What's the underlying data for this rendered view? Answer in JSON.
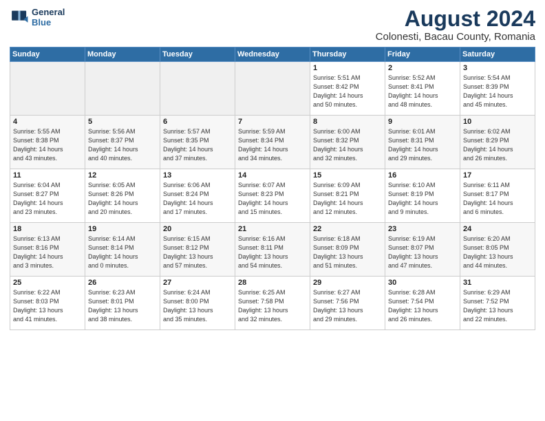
{
  "header": {
    "logo_line1": "General",
    "logo_line2": "Blue",
    "main_title": "August 2024",
    "subtitle": "Colonesti, Bacau County, Romania"
  },
  "weekdays": [
    "Sunday",
    "Monday",
    "Tuesday",
    "Wednesday",
    "Thursday",
    "Friday",
    "Saturday"
  ],
  "weeks": [
    [
      {
        "day": "",
        "info": ""
      },
      {
        "day": "",
        "info": ""
      },
      {
        "day": "",
        "info": ""
      },
      {
        "day": "",
        "info": ""
      },
      {
        "day": "1",
        "info": "Sunrise: 5:51 AM\nSunset: 8:42 PM\nDaylight: 14 hours\nand 50 minutes."
      },
      {
        "day": "2",
        "info": "Sunrise: 5:52 AM\nSunset: 8:41 PM\nDaylight: 14 hours\nand 48 minutes."
      },
      {
        "day": "3",
        "info": "Sunrise: 5:54 AM\nSunset: 8:39 PM\nDaylight: 14 hours\nand 45 minutes."
      }
    ],
    [
      {
        "day": "4",
        "info": "Sunrise: 5:55 AM\nSunset: 8:38 PM\nDaylight: 14 hours\nand 43 minutes."
      },
      {
        "day": "5",
        "info": "Sunrise: 5:56 AM\nSunset: 8:37 PM\nDaylight: 14 hours\nand 40 minutes."
      },
      {
        "day": "6",
        "info": "Sunrise: 5:57 AM\nSunset: 8:35 PM\nDaylight: 14 hours\nand 37 minutes."
      },
      {
        "day": "7",
        "info": "Sunrise: 5:59 AM\nSunset: 8:34 PM\nDaylight: 14 hours\nand 34 minutes."
      },
      {
        "day": "8",
        "info": "Sunrise: 6:00 AM\nSunset: 8:32 PM\nDaylight: 14 hours\nand 32 minutes."
      },
      {
        "day": "9",
        "info": "Sunrise: 6:01 AM\nSunset: 8:31 PM\nDaylight: 14 hours\nand 29 minutes."
      },
      {
        "day": "10",
        "info": "Sunrise: 6:02 AM\nSunset: 8:29 PM\nDaylight: 14 hours\nand 26 minutes."
      }
    ],
    [
      {
        "day": "11",
        "info": "Sunrise: 6:04 AM\nSunset: 8:27 PM\nDaylight: 14 hours\nand 23 minutes."
      },
      {
        "day": "12",
        "info": "Sunrise: 6:05 AM\nSunset: 8:26 PM\nDaylight: 14 hours\nand 20 minutes."
      },
      {
        "day": "13",
        "info": "Sunrise: 6:06 AM\nSunset: 8:24 PM\nDaylight: 14 hours\nand 17 minutes."
      },
      {
        "day": "14",
        "info": "Sunrise: 6:07 AM\nSunset: 8:23 PM\nDaylight: 14 hours\nand 15 minutes."
      },
      {
        "day": "15",
        "info": "Sunrise: 6:09 AM\nSunset: 8:21 PM\nDaylight: 14 hours\nand 12 minutes."
      },
      {
        "day": "16",
        "info": "Sunrise: 6:10 AM\nSunset: 8:19 PM\nDaylight: 14 hours\nand 9 minutes."
      },
      {
        "day": "17",
        "info": "Sunrise: 6:11 AM\nSunset: 8:17 PM\nDaylight: 14 hours\nand 6 minutes."
      }
    ],
    [
      {
        "day": "18",
        "info": "Sunrise: 6:13 AM\nSunset: 8:16 PM\nDaylight: 14 hours\nand 3 minutes."
      },
      {
        "day": "19",
        "info": "Sunrise: 6:14 AM\nSunset: 8:14 PM\nDaylight: 14 hours\nand 0 minutes."
      },
      {
        "day": "20",
        "info": "Sunrise: 6:15 AM\nSunset: 8:12 PM\nDaylight: 13 hours\nand 57 minutes."
      },
      {
        "day": "21",
        "info": "Sunrise: 6:16 AM\nSunset: 8:11 PM\nDaylight: 13 hours\nand 54 minutes."
      },
      {
        "day": "22",
        "info": "Sunrise: 6:18 AM\nSunset: 8:09 PM\nDaylight: 13 hours\nand 51 minutes."
      },
      {
        "day": "23",
        "info": "Sunrise: 6:19 AM\nSunset: 8:07 PM\nDaylight: 13 hours\nand 47 minutes."
      },
      {
        "day": "24",
        "info": "Sunrise: 6:20 AM\nSunset: 8:05 PM\nDaylight: 13 hours\nand 44 minutes."
      }
    ],
    [
      {
        "day": "25",
        "info": "Sunrise: 6:22 AM\nSunset: 8:03 PM\nDaylight: 13 hours\nand 41 minutes."
      },
      {
        "day": "26",
        "info": "Sunrise: 6:23 AM\nSunset: 8:01 PM\nDaylight: 13 hours\nand 38 minutes."
      },
      {
        "day": "27",
        "info": "Sunrise: 6:24 AM\nSunset: 8:00 PM\nDaylight: 13 hours\nand 35 minutes."
      },
      {
        "day": "28",
        "info": "Sunrise: 6:25 AM\nSunset: 7:58 PM\nDaylight: 13 hours\nand 32 minutes."
      },
      {
        "day": "29",
        "info": "Sunrise: 6:27 AM\nSunset: 7:56 PM\nDaylight: 13 hours\nand 29 minutes."
      },
      {
        "day": "30",
        "info": "Sunrise: 6:28 AM\nSunset: 7:54 PM\nDaylight: 13 hours\nand 26 minutes."
      },
      {
        "day": "31",
        "info": "Sunrise: 6:29 AM\nSunset: 7:52 PM\nDaylight: 13 hours\nand 22 minutes."
      }
    ]
  ]
}
